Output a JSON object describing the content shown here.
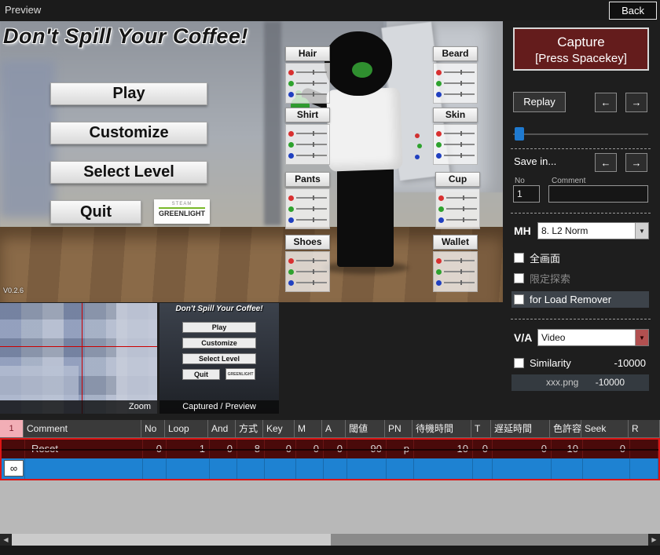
{
  "window": {
    "title": "Preview",
    "back": "Back"
  },
  "game": {
    "title": "Don't Spill Your Coffee!",
    "version": "V0.2.6",
    "menu": {
      "play": "Play",
      "customize": "Customize",
      "select_level": "Select Level",
      "quit": "Quit"
    },
    "greenlight": {
      "steam": "STEAM",
      "name": "GREENLIGHT"
    },
    "panels": [
      "Hair",
      "Beard",
      "Shirt",
      "Skin",
      "Pants",
      "Cup",
      "Shoes",
      "Wallet"
    ]
  },
  "zoom_panel": {
    "label": "Zoom"
  },
  "captured_panel": {
    "label": "Captured / Preview",
    "title": "Don't Spill Your Coffee!",
    "menu": {
      "play": "Play",
      "customize": "Customize",
      "select_level": "Select Level",
      "quit": "Quit"
    },
    "greenlight": "GREENLIGHT"
  },
  "controls": {
    "capture_line1": "Capture",
    "capture_line2": "[Press Spacekey]",
    "replay": "Replay",
    "save_in": "Save in...",
    "no_label": "No",
    "no_value": "1",
    "comment_label": "Comment",
    "comment_value": "",
    "mh_label": "MH",
    "mh_value": "8. L2 Norm",
    "chk_fullscreen": "全画面",
    "chk_limited": "限定探索",
    "chk_load_remover": "for Load Remover",
    "va_label": "V/A",
    "va_value": "Video",
    "similarity_label": "Similarity",
    "similarity_value": "-10000",
    "file_name": "xxx.png",
    "file_value": "-10000"
  },
  "icons": {
    "arrow_left": "←",
    "arrow_right": "→",
    "dropdown": "▼",
    "scroll_left": "◀",
    "scroll_right": "▶",
    "infinity": "∞"
  },
  "table": {
    "corner": "1",
    "headers": [
      "Comment",
      "No",
      "Loop",
      "And",
      "方式",
      "Key",
      "M",
      "A",
      "閾値",
      "PN",
      "待機時間",
      "T",
      "遅延時間",
      "色許容",
      "Seek",
      "R"
    ],
    "reset_row": [
      "Reset",
      "0",
      "1",
      "0",
      "8",
      "0",
      "0",
      "0",
      "90",
      "p",
      "10",
      "0",
      "0",
      "10",
      "0",
      ""
    ]
  },
  "colors": {
    "selection_blue": "#1e82d2",
    "capture_red": "#641c1c",
    "reset_row_red": "#4a0a0a",
    "selection_border_red": "#dc1414",
    "slider_thumb_blue": "#1f7ad0",
    "corner_pink": "#f2aeb6"
  }
}
